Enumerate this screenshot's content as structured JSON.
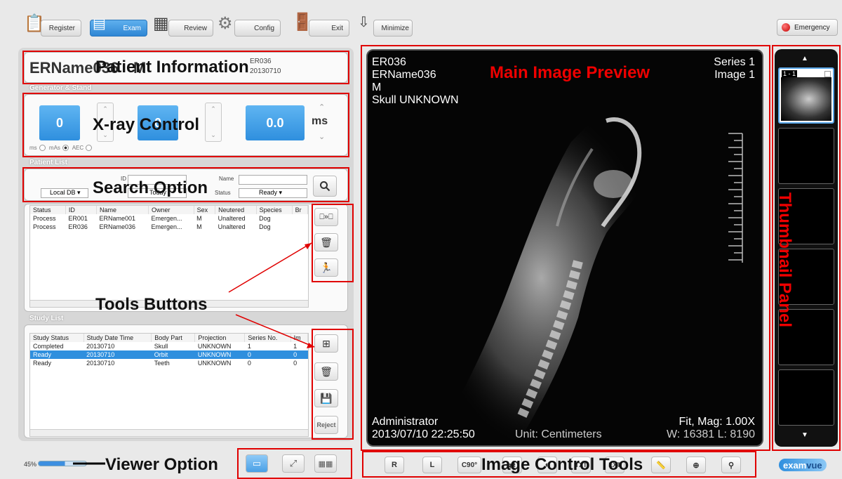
{
  "toolbar": {
    "register": "Register",
    "exam": "Exam",
    "review": "Review",
    "config": "Config",
    "exit": "Exit",
    "minimize": "Minimize",
    "emergency": "Emergency"
  },
  "patient": {
    "name": "ERName036",
    "sex": "M",
    "id": "ER036",
    "date": "20130710"
  },
  "generator": {
    "title": "Generator & Stand",
    "kv": "0",
    "ma": "0",
    "ms": "0.0",
    "ms_unit": "ms",
    "radio_ms": "ms",
    "radio_mas": "mAs",
    "radio_aec": "AEC"
  },
  "patient_list": {
    "title": "Patient List",
    "db": "Local DB",
    "id_label": "ID",
    "name_label": "Name",
    "status_label": "Status",
    "date_value": "Today",
    "status_value": "Ready",
    "columns": [
      "Status",
      "ID",
      "Name",
      "Owner",
      "Sex",
      "Neutered",
      "Species",
      "Br"
    ],
    "rows": [
      [
        "Process",
        "ER001",
        "ERName001",
        "Emergen...",
        "M",
        "Unaltered",
        "Dog",
        ""
      ],
      [
        "Process",
        "ER036",
        "ERName036",
        "Emergen...",
        "M",
        "Unaltered",
        "Dog",
        ""
      ]
    ]
  },
  "study_list": {
    "title": "Study List",
    "columns": [
      "Study Status",
      "Study Date Time",
      "Body Part",
      "Projection",
      "Series No.",
      "Im"
    ],
    "rows": [
      [
        "Completed",
        "20130710",
        "Skull",
        "UNKNOWN",
        "1",
        "1"
      ],
      [
        "Ready",
        "20130710",
        "Orbit",
        "UNKNOWN",
        "0",
        "0"
      ],
      [
        "Ready",
        "20130710",
        "Teeth",
        "UNKNOWN",
        "0",
        "0"
      ]
    ],
    "reject": "Reject"
  },
  "viewer": {
    "id": "ER036",
    "name": "ERName036",
    "sex": "M",
    "study": "Skull UNKNOWN",
    "series": "Series 1",
    "image": "Image 1",
    "user": "Administrator",
    "datetime": "2013/07/10 22:25:50",
    "unit": "Unit: Centimeters",
    "fit": "Fit, Mag: 1.00X",
    "wl": "W: 16381 L: 8190"
  },
  "thumbnail": {
    "label": "1 - 1"
  },
  "bottom": {
    "zoom": "45%",
    "brand_exam": "exam",
    "brand_vue": "vue",
    "btn_r": "R",
    "btn_l": "L",
    "btn_rotate": "C90°",
    "btn_txt": "TXT",
    "btn_ext": "EXT"
  },
  "annotations": {
    "patient_info": "Patient Information",
    "xray_control": "X-ray Control",
    "search_option": "Search Option",
    "tools_buttons": "Tools Buttons",
    "viewer_option": "Viewer Option",
    "main_preview": "Main Image Preview",
    "image_control": "Image Control Tools",
    "thumbnail_panel": "Thumbnail Panel"
  }
}
